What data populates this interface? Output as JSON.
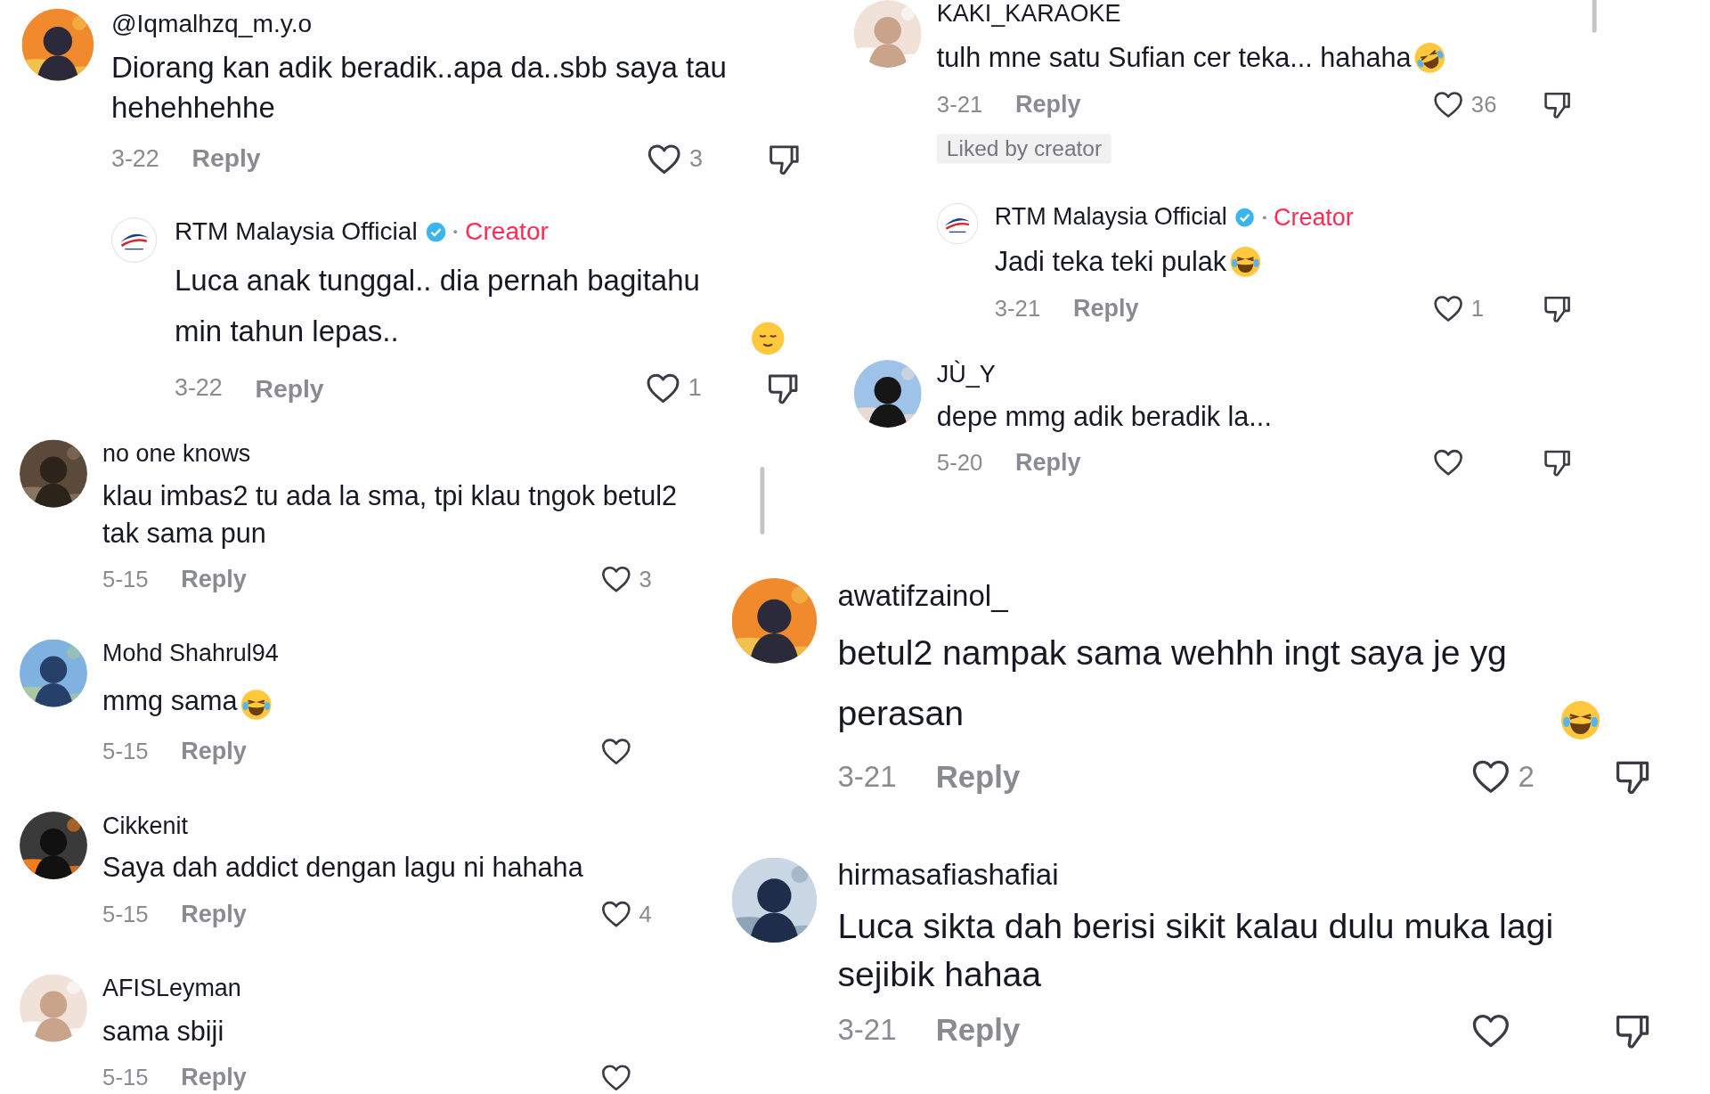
{
  "sections": [
    {
      "show_dislike": true,
      "comments": [
        {
          "user": "@Iqmalhzq_m.y.o",
          "verified": false,
          "avatar": {
            "kind": "picture"
          },
          "text": "Diorang kan adik beradik..apa da..sbb saya tau hehehhehhe",
          "date": "3-22",
          "reply": "Reply",
          "likes": "3",
          "replies": [
            {
              "user": "RTM Malaysia Official",
              "verified": true,
              "creator_label": "Creator",
              "avatar": {
                "kind": "logo"
              },
              "text": "Luca anak tunggal.. dia pernah bagitahu min tahun lepas..",
              "emoji": {
                "kind": "relieved"
              },
              "date": "3-22",
              "reply": "Reply",
              "likes": "1"
            }
          ]
        }
      ]
    },
    {
      "show_dislike": false,
      "comments": [
        {
          "user": "no one knows",
          "verified": false,
          "avatar": {
            "kind": "picture"
          },
          "text": "klau imbas2 tu ada la sma, tpi klau tngok betul2 tak sama pun",
          "date": "5-15",
          "reply": "Reply",
          "likes": "3"
        },
        {
          "user": "Mohd Shahrul94",
          "verified": false,
          "avatar": {
            "kind": "picture"
          },
          "text": "mmg sama",
          "emoji": {
            "kind": "laughing"
          },
          "date": "5-15",
          "reply": "Reply"
        },
        {
          "user": "Cikkenit",
          "verified": false,
          "avatar": {
            "kind": "picture"
          },
          "text": "Saya dah addict dengan lagu ni hahaha",
          "date": "5-15",
          "reply": "Reply",
          "likes": "4"
        },
        {
          "user": "AFISLeyman",
          "verified": false,
          "avatar": {
            "kind": "picture"
          },
          "text": "sama sbiji",
          "date": "5-15",
          "reply": "Reply"
        }
      ]
    },
    {
      "show_dislike": true,
      "comments": [
        {
          "user": "KAKI_KARAOKE",
          "verified": false,
          "avatar": {
            "kind": "picture"
          },
          "text": "tulh mne satu Sufian cer teka... hahaha",
          "emoji": {
            "kind": "rofl"
          },
          "date": "3-21",
          "reply": "Reply",
          "likes": "36",
          "liked_badge": "Liked by creator",
          "replies": [
            {
              "user": "RTM Malaysia Official",
              "verified": true,
              "creator_label": "Creator",
              "avatar": {
                "kind": "logo"
              },
              "text": "Jadi teka teki pulak",
              "emoji": {
                "kind": "laughing"
              },
              "date": "3-21",
              "reply": "Reply",
              "likes": "1"
            }
          ]
        },
        {
          "user": "JÙ_Y",
          "verified": false,
          "avatar": {
            "kind": "picture"
          },
          "text": "depe mmg adik beradik la...",
          "date": "5-20",
          "reply": "Reply"
        }
      ]
    },
    {
      "show_dislike": true,
      "comments": [
        {
          "user": "awatifzainol_",
          "verified": false,
          "avatar": {
            "kind": "picture"
          },
          "text": "betul2 nampak sama wehhh ingt saya je yg perasan",
          "emoji": {
            "kind": "laughing"
          },
          "date": "3-21",
          "reply": "Reply",
          "likes": "2"
        },
        {
          "user": "hirmasafiashafiai",
          "verified": false,
          "avatar": {
            "kind": "picture"
          },
          "text": "Luca sikta dah berisi sikit kalau dulu muka lagi sejibik hahaa",
          "date": "3-21",
          "reply": "Reply"
        }
      ]
    }
  ]
}
